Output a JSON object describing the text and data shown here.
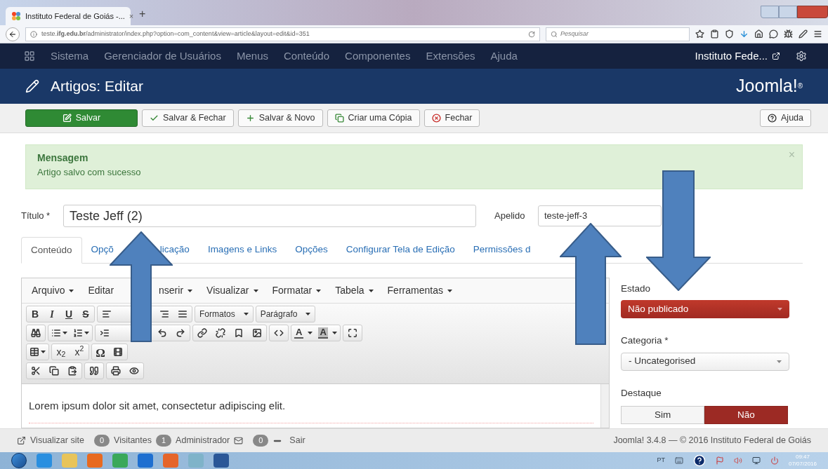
{
  "browser": {
    "tab_title": "Instituto Federal de Goiás -...",
    "tab_close": "×",
    "new_tab": "+",
    "url": "teste.**ifg.edu.br**/administrator/index.php?option=com_content&view=article&layout=edit&id=351",
    "search_placeholder": "Pesquisar"
  },
  "navbar": {
    "items": [
      "Sistema",
      "Gerenciador de Usuários",
      "Menus",
      "Conteúdo",
      "Componentes",
      "Extensões",
      "Ajuda"
    ],
    "site": "Instituto Fede..."
  },
  "header": {
    "title": "Artigos: Editar",
    "logo": "Joomla!",
    "logo_mark": "®"
  },
  "toolbar": [
    {
      "label": "Salvar",
      "kind": "primary"
    },
    {
      "label": "Salvar & Fechar",
      "kind": "default"
    },
    {
      "label": "Salvar & Novo",
      "kind": "default"
    },
    {
      "label": "Criar uma Cópia",
      "kind": "default"
    },
    {
      "label": "Fechar",
      "kind": "default"
    },
    {
      "label": "Ajuda",
      "kind": "help"
    }
  ],
  "message": {
    "title": "Mensagem",
    "text": "Artigo salvo com sucesso",
    "close": "×"
  },
  "title_field": {
    "label": "Título *",
    "value": "Teste Jeff (2)"
  },
  "alias_field": {
    "label": "Apelido",
    "value": "teste-jeff-3"
  },
  "tabs": [
    {
      "label": "Conteúdo",
      "selected": true
    },
    {
      "label": "Opçõ",
      "label_after": "licação",
      "selected": false
    },
    {
      "label": "Imagens e Links",
      "selected": false
    },
    {
      "label": "Opções",
      "selected": false
    },
    {
      "label": "Configurar Tela de Edição",
      "selected": false
    },
    {
      "label": "Permissões d",
      "selected": false
    }
  ],
  "editor": {
    "menu": [
      {
        "label": "Arquivo",
        "caret": true
      },
      {
        "label": "Editar",
        "caret": false
      },
      {
        "label": "nserir",
        "caret": true
      },
      {
        "label": "Visualizar",
        "caret": true
      },
      {
        "label": "Formatar",
        "caret": true
      },
      {
        "label": "Tabela",
        "caret": true
      },
      {
        "label": "Ferramentas",
        "caret": true
      }
    ],
    "rows": [
      [
        [
          {
            "kind": "bold",
            "label": "B"
          },
          {
            "kind": "italic",
            "label": "I"
          },
          {
            "kind": "underline",
            "label": "U"
          },
          {
            "kind": "strike",
            "label": "S"
          }
        ],
        [
          {
            "kind": "icon"
          },
          {
            "kind": "gap"
          },
          {
            "kind": "icon"
          },
          {
            "kind": "icon"
          }
        ],
        [
          {
            "kind": "dropdown",
            "label": "Formatos"
          }
        ],
        [
          {
            "kind": "dropdown",
            "label": "Parágrafo"
          }
        ]
      ],
      [
        [
          {
            "kind": "icon"
          }
        ],
        [
          {
            "kind": "iconmenu"
          },
          {
            "kind": "iconmenu"
          }
        ],
        [
          {
            "kind": "icon"
          },
          {
            "kind": "gap"
          },
          {
            "kind": "icon"
          },
          {
            "kind": "icon"
          }
        ],
        [
          {
            "kind": "icon"
          },
          {
            "kind": "icon"
          },
          {
            "kind": "icon"
          },
          {
            "kind": "icon"
          }
        ],
        [
          {
            "kind": "icon"
          }
        ],
        [
          {
            "kind": "color",
            "label": "A"
          },
          {
            "kind": "highlight",
            "label": "A"
          }
        ],
        [
          {
            "kind": "icon"
          }
        ]
      ],
      [
        [
          {
            "kind": "iconmenu"
          }
        ],
        [
          {
            "kind": "script",
            "label": "x$_{2}$"
          },
          {
            "kind": "script",
            "label": "x$^{2}$"
          }
        ],
        [
          {
            "kind": "symbol",
            "label": "Ω"
          },
          {
            "kind": "icon"
          }
        ]
      ],
      [
        [
          {
            "kind": "icon"
          },
          {
            "kind": "icon"
          },
          {
            "kind": "icon"
          }
        ],
        [
          {
            "kind": "icon"
          }
        ],
        [
          {
            "kind": "icon"
          },
          {
            "kind": "icon"
          }
        ]
      ]
    ],
    "text": "Lorem ipsum dolor sit amet, consectetur adipiscing elit."
  },
  "sidebar": {
    "status": {
      "label": "Estado",
      "value": "Não publicado"
    },
    "category": {
      "label": "Categoria *",
      "value": "- Uncategorised"
    },
    "featured": {
      "label": "Destaque",
      "options": [
        {
          "label": "Sim",
          "selected": false
        },
        {
          "label": "Não",
          "selected": true
        }
      ]
    }
  },
  "status_bar": {
    "view_site": "Visualizar site",
    "visitors_count": "0",
    "visitors": "Visitantes",
    "admins_count": "1",
    "admins": "Administrador",
    "messages_count": "0",
    "logout": "Sair",
    "copyright": "Joomla! 3.4.8 — © 2016 Instituto Federal de Goiás"
  },
  "taskbar": {
    "language": "PT",
    "time": "09:47",
    "date": "07/07/2016"
  }
}
